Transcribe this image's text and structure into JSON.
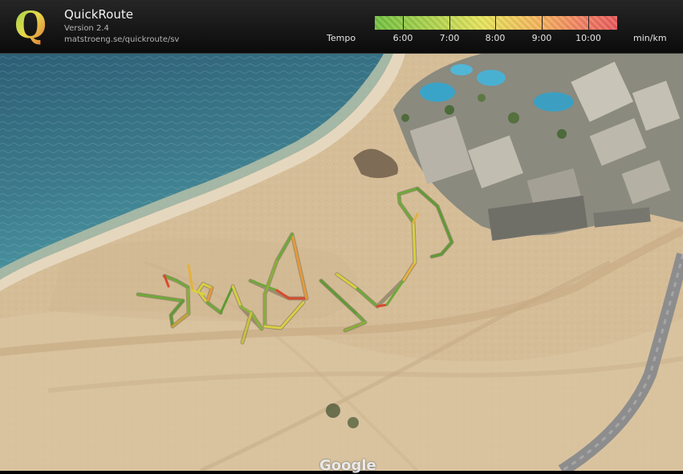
{
  "app": {
    "title": "QuickRoute",
    "version": "Version 2.4",
    "url": "matstroeng.se/quickroute/sv",
    "logo_letter": "Q"
  },
  "legend": {
    "title": "Tempo",
    "labels": [
      "6:00",
      "7:00",
      "8:00",
      "9:00",
      "10:00"
    ],
    "unit": "min/km",
    "colors": {
      "fast": "#6fbf3c",
      "medium": "#e7e35a",
      "slow": "#e8585a"
    }
  },
  "map": {
    "watermark": "Google",
    "route_colors": {
      "green": "#6ea83a",
      "yellow": "#d8cf42",
      "orange": "#e49a3c",
      "red": "#d84a2e"
    }
  }
}
